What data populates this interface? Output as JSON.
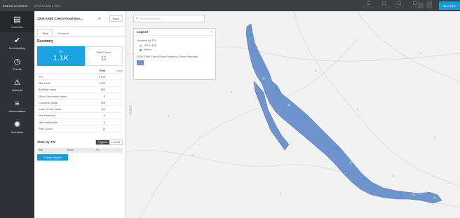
{
  "topbar": {
    "breadcrumb": "ELEVE Locations",
    "filter_hint": "Click to add a filter",
    "save_label": "Save Filter"
  },
  "nav": [
    {
      "icon": "chart-icon",
      "label": "Overview"
    },
    {
      "icon": "check-icon",
      "label": "Underwriting"
    },
    {
      "icon": "clock-icon",
      "label": "Events"
    },
    {
      "icon": "warning-icon",
      "label": "Hazards"
    },
    {
      "icon": "stack-icon",
      "label": "Accumulation"
    },
    {
      "icon": "scenario-icon",
      "label": "Scenarios"
    }
  ],
  "panel": {
    "title": "2006-XXIM Czech Flood Eve...",
    "back_label": "Back",
    "tabs": [
      "Total",
      "Footprint"
    ],
    "summary_title": "Summary",
    "kpi_main_label": "TIV",
    "kpi_main_value": "1.1K",
    "kpi_sec_label": "Risk Count",
    "kpi_sec_value": "11",
    "table_headers": [
      "",
      "Total",
      "Loss"
    ],
    "rows": [
      {
        "name": "TIV",
        "total": "1,100",
        "loss": "-"
      },
      {
        "name": "Site Limit",
        "total": "1,100",
        "loss": "-"
      },
      {
        "name": "Building Value",
        "total": "860",
        "loss": "-"
      },
      {
        "name": "Other Structures Value",
        "total": "0",
        "loss": "-"
      },
      {
        "name": "Contents Value",
        "total": "150",
        "loss": "-"
      },
      {
        "name": "Loss of Use Value",
        "total": "110",
        "loss": "-"
      },
      {
        "name": "Site Premium",
        "total": "0",
        "loss": "-"
      },
      {
        "name": "Site Deductible",
        "total": "0",
        "loss": "-"
      },
      {
        "name": "Risk Count",
        "total": "11",
        "loss": "-"
      }
    ],
    "sites_title": "Sites by TIV",
    "toggle": [
      "Highest",
      "Lowest"
    ],
    "sites_cols": [
      "Site",
      "AccId",
      "TIV"
    ],
    "create_label": "Create Report"
  },
  "map": {
    "search_placeholder": "Search Address",
    "legend_title": "Legend",
    "legend_close": "×",
    "legend_loc_title": "Location by TIV",
    "legend_items": [
      {
        "label": "100 to 150",
        "color": "#7fd3b5"
      },
      {
        "label": "others",
        "color": "#1aa3e0"
      }
    ],
    "legend_footprint": "2006-XXIM Czech Flood Footprint (Czech Republic)",
    "flood_color": "#6f93cc",
    "tools": [
      "Deselect",
      "Select On Map",
      "Measure",
      "Basemaps",
      "Layers"
    ]
  }
}
